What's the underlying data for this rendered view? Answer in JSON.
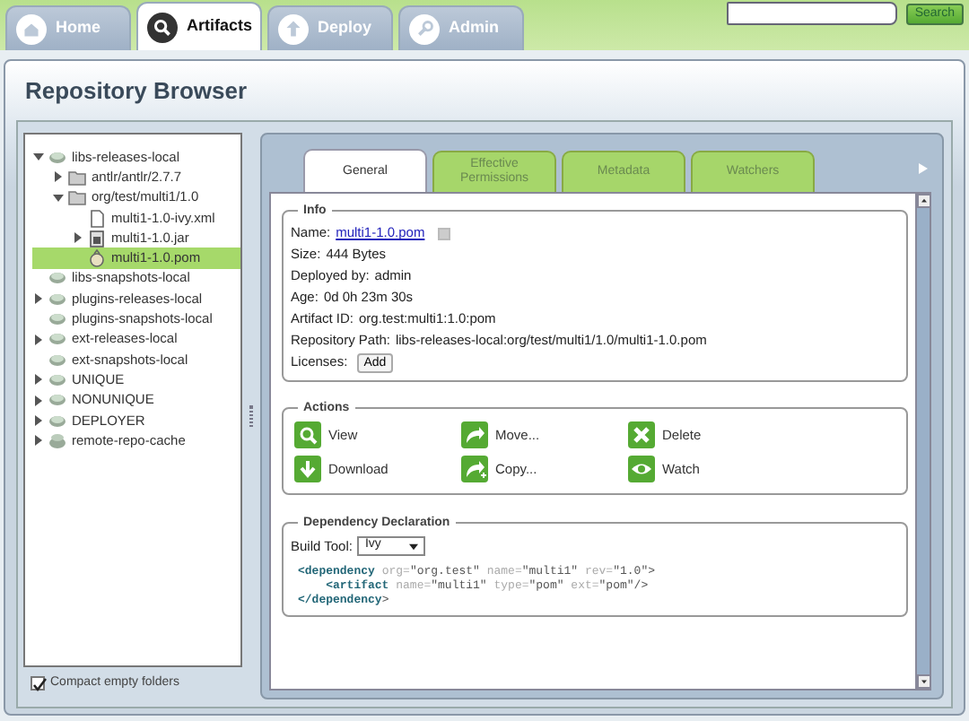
{
  "nav_tabs": [
    {
      "label": "Home",
      "kind": "home",
      "selected": false
    },
    {
      "label": "Artifacts",
      "kind": "search",
      "selected": true
    },
    {
      "label": "Deploy",
      "kind": "deploy",
      "selected": false
    },
    {
      "label": "Admin",
      "kind": "admin",
      "selected": false
    }
  ],
  "search": {
    "button": "Search"
  },
  "title": "Repository Browser",
  "tree": [
    {
      "label": "libs-releases-local",
      "kind": "repo",
      "expanded": true,
      "selected": false,
      "children": [
        {
          "label": "antlr/antlr/2.7.7",
          "kind": "folder",
          "expanded": false,
          "selected": false
        },
        {
          "label": "org/test/multi1/1.0",
          "kind": "folder",
          "expanded": true,
          "selected": false,
          "children": [
            {
              "label": "multi1-1.0-ivy.xml",
              "kind": "file",
              "selected": false
            },
            {
              "label": "multi1-1.0.jar",
              "kind": "jar",
              "expanded": false,
              "selected": false
            },
            {
              "label": "multi1-1.0.pom",
              "kind": "pom",
              "selected": true
            }
          ]
        }
      ]
    },
    {
      "label": "libs-snapshots-local",
      "kind": "repo",
      "selected": false
    },
    {
      "label": "plugins-releases-local",
      "kind": "repo",
      "expanded": false,
      "selected": false
    },
    {
      "label": "plugins-snapshots-local",
      "kind": "repo",
      "selected": false
    },
    {
      "label": "ext-releases-local",
      "kind": "repo",
      "expanded": false,
      "selected": false
    },
    {
      "label": "ext-snapshots-local",
      "kind": "repo",
      "selected": false
    },
    {
      "label": "UNIQUE",
      "kind": "repo",
      "expanded": false,
      "selected": false
    },
    {
      "label": "NONUNIQUE",
      "kind": "repo",
      "expanded": false,
      "selected": false
    },
    {
      "label": "DEPLOYER",
      "kind": "repo",
      "expanded": false,
      "selected": false
    },
    {
      "label": "remote-repo-cache",
      "kind": "remote",
      "expanded": false,
      "selected": false
    }
  ],
  "compact_folders": {
    "label": "Compact empty folders",
    "checked": true
  },
  "detail_tabs": [
    {
      "label": "General",
      "selected": true
    },
    {
      "label": "Effective Permissions",
      "selected": false
    },
    {
      "label": "Metadata",
      "selected": false
    },
    {
      "label": "Watchers",
      "selected": false
    }
  ],
  "info": {
    "legend": "Info",
    "rows": [
      {
        "label": "Name:",
        "kind": "link",
        "value": "multi1-1.0.pom"
      },
      {
        "label": "Size:",
        "kind": "text",
        "value": "444 Bytes"
      },
      {
        "label": "Deployed by:",
        "kind": "text",
        "value": "admin"
      },
      {
        "label": "Age:",
        "kind": "text",
        "value": "0d 0h 23m 30s"
      },
      {
        "label": "Artifact ID:",
        "kind": "text",
        "value": "org.test:multi1:1.0:pom"
      },
      {
        "label": "Repository Path:",
        "kind": "text",
        "value": "libs-releases-local:org/test/multi1/1.0/multi1-1.0.pom"
      },
      {
        "label": "Licenses:",
        "kind": "button",
        "value": "Add"
      }
    ]
  },
  "actions": {
    "legend": "Actions",
    "items": [
      {
        "label": "View",
        "kind": "view"
      },
      {
        "label": "Move...",
        "kind": "move"
      },
      {
        "label": "Delete",
        "kind": "delete"
      },
      {
        "label": "Download",
        "kind": "download"
      },
      {
        "label": "Copy...",
        "kind": "copy"
      },
      {
        "label": "Watch",
        "kind": "watch"
      }
    ]
  },
  "dependency": {
    "legend": "Dependency Declaration",
    "build_tool_label": "Build Tool:",
    "build_tool": "Ivy",
    "code": [
      [
        {
          "kind": "tag",
          "text": "<dependency"
        },
        {
          "kind": "attr",
          "text": " org="
        },
        {
          "kind": "val",
          "text": "\"org.test\""
        },
        {
          "kind": "attr",
          "text": " name="
        },
        {
          "kind": "val",
          "text": "\"multi1\""
        },
        {
          "kind": "attr",
          "text": " rev="
        },
        {
          "kind": "val",
          "text": "\"1.0\""
        },
        {
          "kind": "punct",
          "text": ">"
        }
      ],
      [
        {
          "kind": "tag",
          "text": "    <artifact"
        },
        {
          "kind": "attr",
          "text": " name="
        },
        {
          "kind": "val",
          "text": "\"multi1\""
        },
        {
          "kind": "attr",
          "text": " type="
        },
        {
          "kind": "val",
          "text": "\"pom\""
        },
        {
          "kind": "attr",
          "text": " ext="
        },
        {
          "kind": "val",
          "text": "\"pom\""
        },
        {
          "kind": "punct",
          "text": "/>"
        }
      ],
      [
        {
          "kind": "tag",
          "text": "</dependency"
        },
        {
          "kind": "punct",
          "text": ">"
        }
      ]
    ]
  }
}
